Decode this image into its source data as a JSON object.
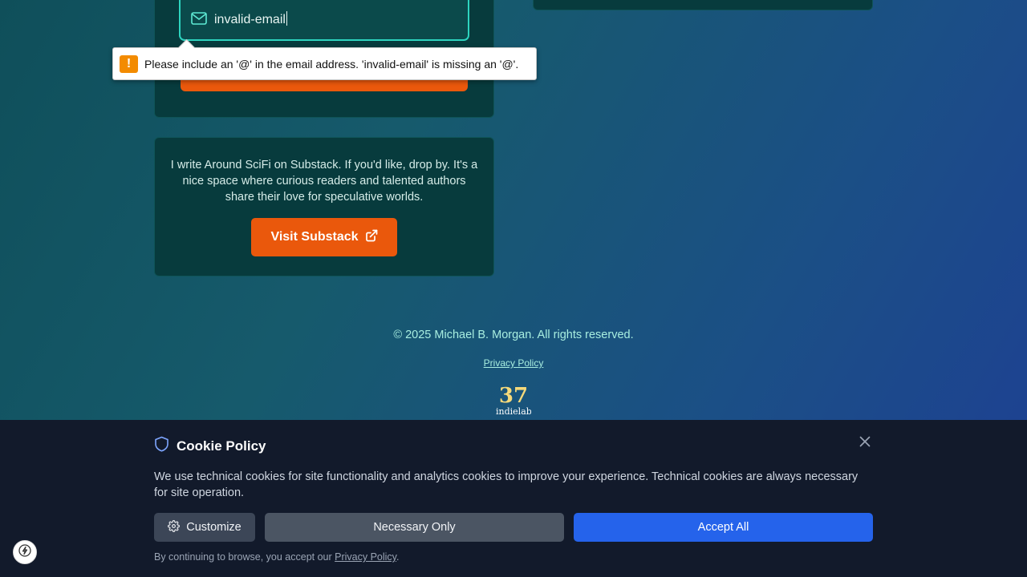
{
  "newsletter": {
    "email_value": "invalid-email",
    "validation_message": "Please include an '@' in the email address. 'invalid-email' is missing an '@'."
  },
  "substack": {
    "description": "I write Around SciFi on Substack. If you'd like, drop by. It's a nice space where curious readers and talented authors share their love for speculative worlds.",
    "button_label": "Visit Substack"
  },
  "footer": {
    "copyright": "© 2025 Michael B. Morgan. All rights reserved.",
    "privacy_link": "Privacy Policy",
    "logo_number": "37",
    "logo_text": "indielab"
  },
  "cookie_banner": {
    "title": "Cookie Policy",
    "description": "We use technical cookies for site functionality and analytics cookies to improve your experience. Technical cookies are always necessary for site operation.",
    "customize_label": "Customize",
    "necessary_label": "Necessary Only",
    "accept_label": "Accept All",
    "footer_prefix": "By continuing to browse, you accept our ",
    "footer_link": "Privacy Policy",
    "footer_suffix": "."
  },
  "colors": {
    "accent_orange": "#ea580c",
    "accept_blue": "#2563eb",
    "field_border": "#2dd4bf",
    "card_bg": "#073b3d",
    "banner_bg": "#121a2b"
  },
  "icons": [
    "mail-icon",
    "warning-icon",
    "external-link-icon",
    "shield-icon",
    "close-icon",
    "gear-icon",
    "bolt-icon"
  ]
}
